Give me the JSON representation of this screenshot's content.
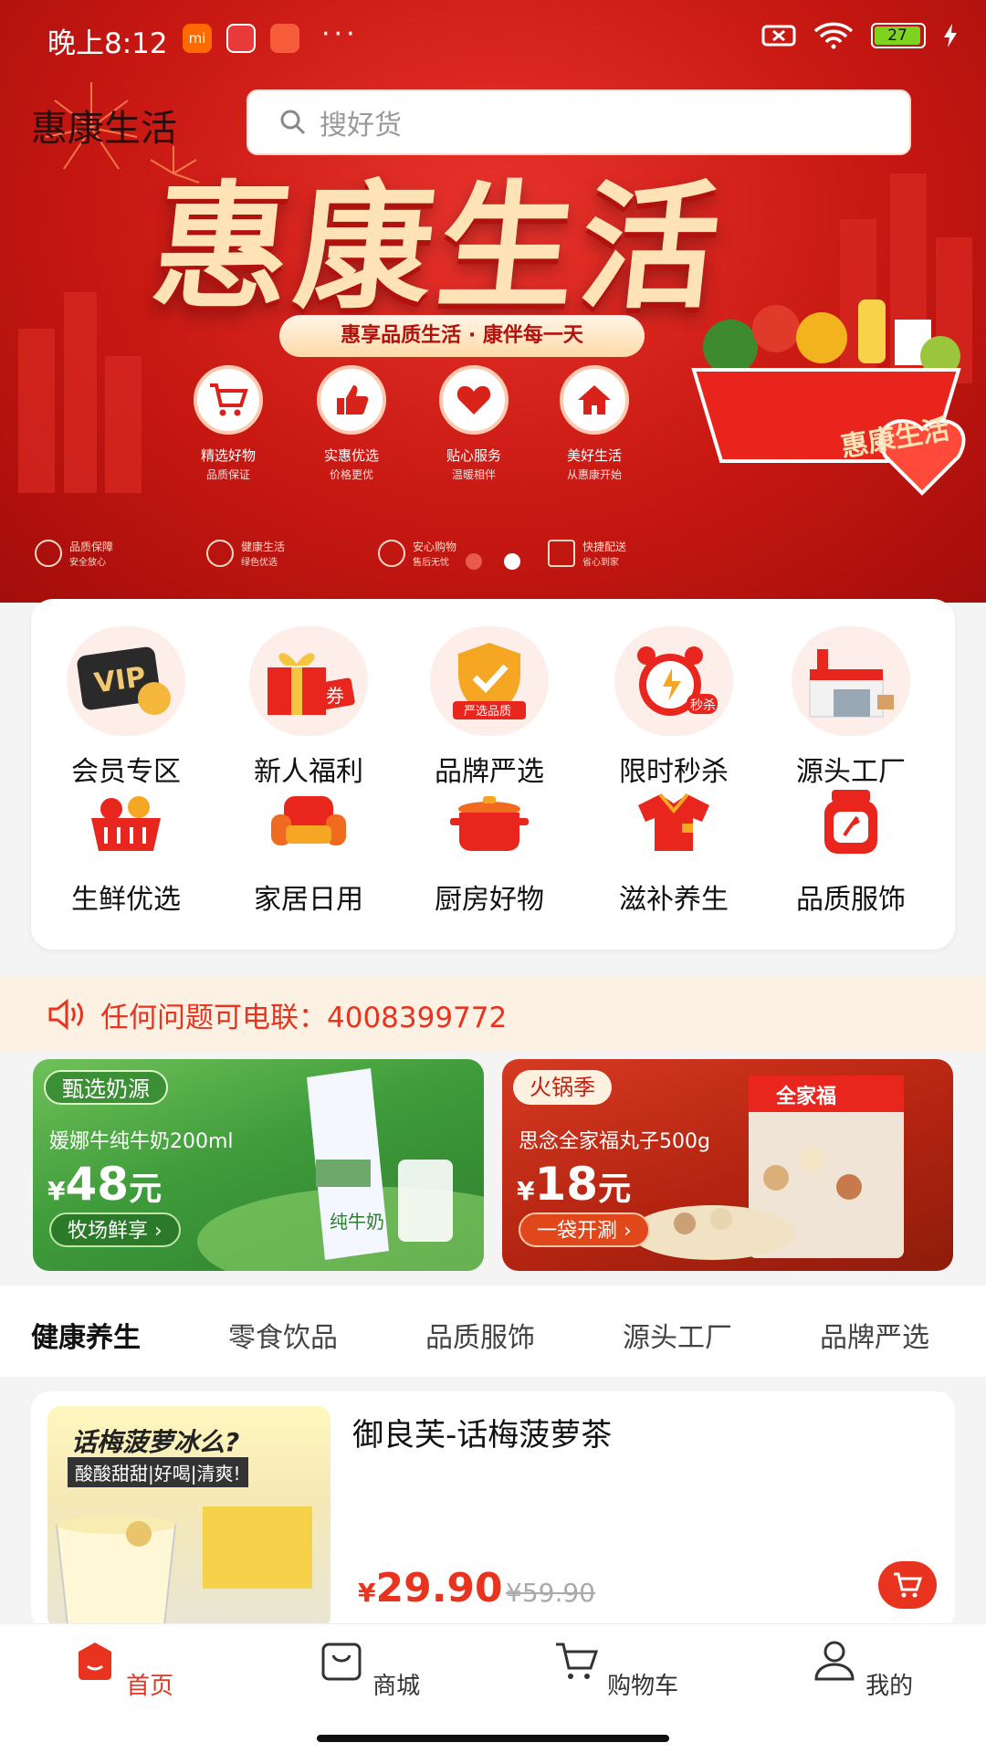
{
  "status_bar": {
    "time": "晚上8:12",
    "mi_label": "mi",
    "battery": "27",
    "dots": "···"
  },
  "header": {
    "brand": "惠康生活",
    "search_placeholder": "搜好货"
  },
  "banner": {
    "title": "惠康生活",
    "slogan": "惠享品质生活 · 康伴每一天",
    "features": [
      {
        "title": "精选好物",
        "sub": "品质保证"
      },
      {
        "title": "实惠优选",
        "sub": "价格更优"
      },
      {
        "title": "贴心服务",
        "sub": "温暖相伴"
      },
      {
        "title": "美好生活",
        "sub": "从惠康开始"
      }
    ],
    "badges": [
      {
        "title": "品质保障",
        "sub": "安全放心"
      },
      {
        "title": "健康生活",
        "sub": "绿色优选"
      },
      {
        "title": "安心购物",
        "sub": "售后无忧"
      },
      {
        "title": "快捷配送",
        "sub": "省心到家"
      }
    ],
    "basket_label": "惠康生活",
    "active_slide": 2,
    "slide_count": 2
  },
  "categories": [
    {
      "label": "会员专区",
      "icon": "vip-card-icon"
    },
    {
      "label": "新人福利",
      "icon": "gift-box-icon"
    },
    {
      "label": "品牌严选",
      "icon": "shield-check-icon"
    },
    {
      "label": "限时秒杀",
      "icon": "alarm-clock-icon"
    },
    {
      "label": "源头工厂",
      "icon": "factory-icon"
    },
    {
      "label": "生鲜优选",
      "icon": "fruit-basket-icon"
    },
    {
      "label": "家居日用",
      "icon": "sofa-icon"
    },
    {
      "label": "厨房好物",
      "icon": "pot-icon"
    },
    {
      "label": "滋补养生",
      "icon": "shirt-icon"
    },
    {
      "label": "品质服饰",
      "icon": "jar-icon"
    }
  ],
  "category_badges": {
    "vip": "VIP",
    "coupon": "券",
    "brand": "严选品质",
    "seckill": "秒杀"
  },
  "notice": {
    "text": "任何问题可电联：4008399772"
  },
  "promos": [
    {
      "tag": "甄选奶源",
      "desc": "媛娜牛纯牛奶200ml",
      "yen": "¥",
      "price": "48",
      "unit": "元",
      "button": "牧场鲜享 ›",
      "pack_label": "纯牛奶"
    },
    {
      "tag": "火锅季",
      "desc": "思念全家福丸子500g",
      "yen": "¥",
      "price": "18",
      "unit": "元",
      "button": "一袋开涮 ›",
      "pack_label": "全家福"
    }
  ],
  "tabs": [
    "健康养生",
    "零食饮品",
    "品质服饰",
    "源头工厂",
    "品牌严选"
  ],
  "product": {
    "name": "御良芙-话梅菠萝茶",
    "yen": "¥",
    "price": "29.90",
    "old_price": "¥59.90",
    "img_text1": "话梅菠萝冰么?",
    "img_text2": "酸酸甜甜|好喝|清爽!"
  },
  "nav": [
    {
      "label": "首页"
    },
    {
      "label": "商城"
    },
    {
      "label": "购物车"
    },
    {
      "label": "我的"
    }
  ],
  "colors": {
    "brand_red": "#e8341f",
    "hero_red": "#c81812",
    "cream": "#ffe2b6",
    "notice_bg": "#fcf1e3"
  }
}
